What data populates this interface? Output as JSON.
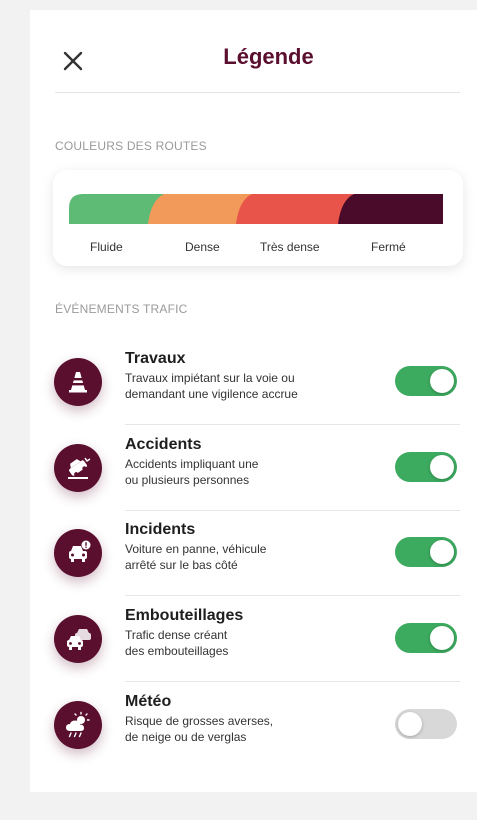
{
  "header": {
    "title": "Légende",
    "close_icon": "close-icon"
  },
  "road_colors": {
    "section_label": "COULEURS DES ROUTES",
    "items": [
      {
        "label": "Fluide",
        "color": "#5dbb76"
      },
      {
        "label": "Dense",
        "color": "#f29a5a"
      },
      {
        "label": "Très dense",
        "color": "#e8544a"
      },
      {
        "label": "Fermé",
        "color": "#4a0a2a"
      }
    ]
  },
  "traffic_events": {
    "section_label": "ÉVÉNEMENTS TRAFIC",
    "items": [
      {
        "title": "Travaux",
        "description": "Travaux impiétant sur la voie ou\ndemandant une vigilence accrue",
        "icon": "traffic-cone-icon",
        "enabled": true
      },
      {
        "title": "Accidents",
        "description": "Accidents impliquant une\nou plusieurs personnes",
        "icon": "car-crash-icon",
        "enabled": true
      },
      {
        "title": "Incidents",
        "description": "Voiture en panne, véhicule\narrêté sur le bas côté",
        "icon": "car-breakdown-icon",
        "enabled": true
      },
      {
        "title": "Embouteillages",
        "description": "Trafic dense créant\ndes embouteillages",
        "icon": "traffic-jam-icon",
        "enabled": true
      },
      {
        "title": "Météo",
        "description": "Risque de grosses averses,\nde neige ou de verglas",
        "icon": "weather-storm-icon",
        "enabled": false
      }
    ]
  },
  "colors": {
    "accent": "#5a0f2e",
    "toggle_on": "#3cab5f",
    "toggle_off": "#d8d8d8"
  }
}
